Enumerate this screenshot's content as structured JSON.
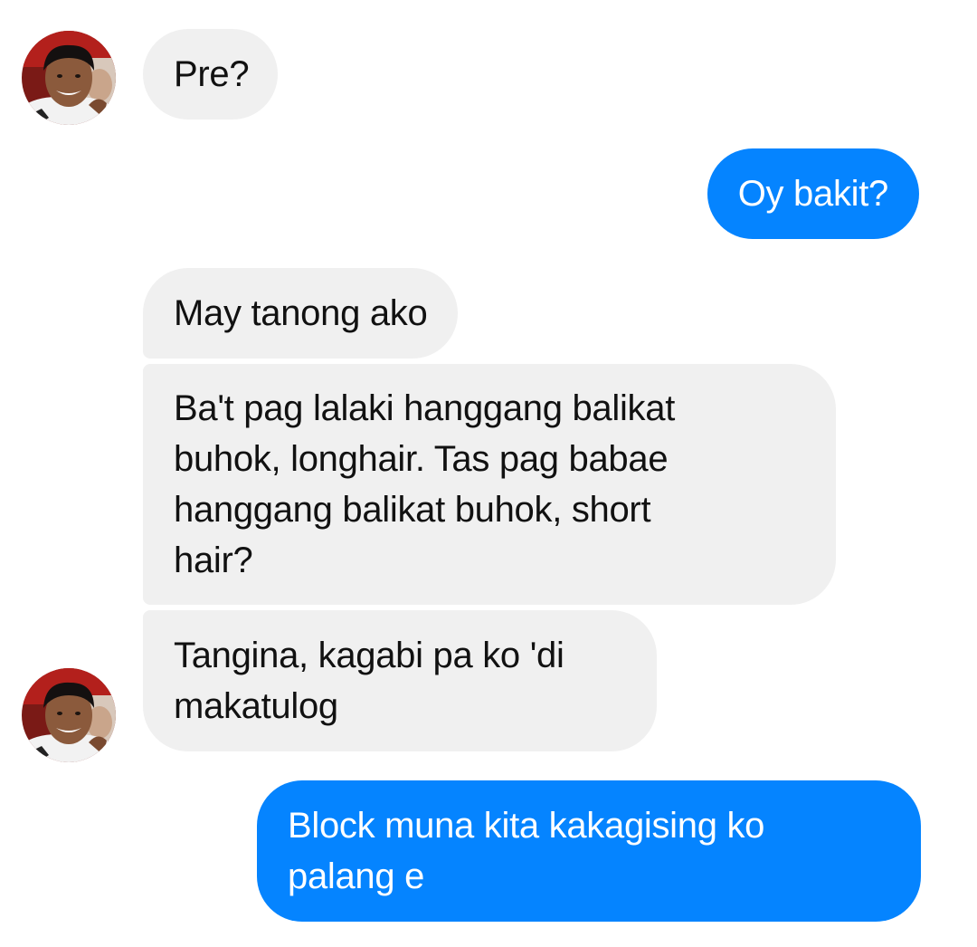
{
  "conversation": {
    "contact_avatar_icon": "profile-photo-icon",
    "messages": [
      {
        "sender": "contact",
        "lines": [
          "Pre?"
        ]
      },
      {
        "sender": "me",
        "lines": [
          "Oy bakit?"
        ]
      },
      {
        "sender": "contact",
        "lines": [
          "May tanong ako"
        ]
      },
      {
        "sender": "contact",
        "lines": [
          "Ba't pag lalaki hanggang balikat",
          "buhok, longhair. Tas pag babae",
          "hanggang balikat buhok, short",
          "hair?"
        ]
      },
      {
        "sender": "contact",
        "lines": [
          "Tangina, kagabi pa ko 'di",
          "makatulog"
        ]
      },
      {
        "sender": "me",
        "lines": [
          "Block muna kita  kakagising ko",
          "palang e"
        ]
      }
    ]
  },
  "colors": {
    "outgoing_bubble": "#0584ff",
    "incoming_bubble": "#f0f0f0",
    "incoming_text": "#111111",
    "outgoing_text": "#ffffff"
  }
}
